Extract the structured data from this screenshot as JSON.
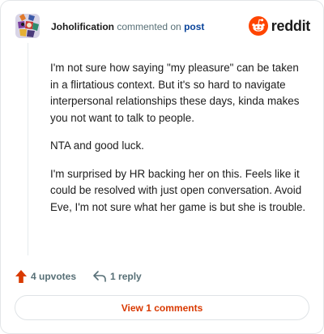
{
  "comment": {
    "username": "Joholification",
    "action_text": "commented on",
    "post_link": "post",
    "paragraphs": [
      "I'm not sure how saying \"my pleasure\" can be taken in a flirtatious context. But it's so hard to navigate interpersonal relationships these days, kinda makes you not want to talk to people.",
      "NTA and good luck.",
      "I'm surprised by HR backing her on this. Feels like it could be resolved with just open conversation. Avoid Eve, I'm not sure what her game is but she is trouble."
    ]
  },
  "brand": {
    "name": "reddit",
    "icon": "reddit-logo-icon",
    "color": "#ff4500"
  },
  "actions": {
    "upvotes_label": "4 upvotes",
    "upvote_icon": "upvote-arrow-icon",
    "upvote_color": "#d93a00",
    "reply_label": "1 reply",
    "reply_icon": "reply-arrow-icon"
  },
  "footer": {
    "view_comments_label": "View 1 comments",
    "accent_color": "#d93900"
  }
}
